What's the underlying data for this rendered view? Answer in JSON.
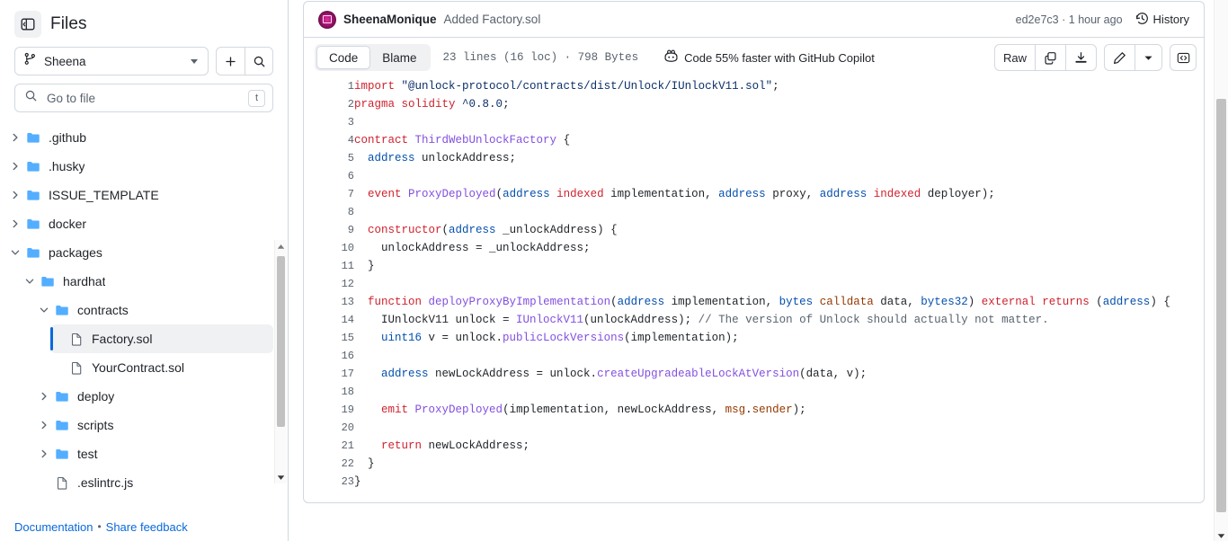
{
  "sidebar": {
    "title": "Files",
    "collapse_icon": "sidebar-collapse-icon",
    "branch": {
      "name": "Sheena",
      "icon": "git-branch-icon"
    },
    "add_button_icon": "plus-icon",
    "search_button_icon": "search-icon",
    "goto_file": {
      "placeholder": "Go to file",
      "value": "",
      "kbd": "t",
      "icon": "search-icon"
    },
    "tree": [
      {
        "label": ".github",
        "type": "folder",
        "depth": 0,
        "state": "collapsed",
        "selected": false
      },
      {
        "label": ".husky",
        "type": "folder",
        "depth": 0,
        "state": "collapsed",
        "selected": false
      },
      {
        "label": "ISSUE_TEMPLATE",
        "type": "folder",
        "depth": 0,
        "state": "collapsed",
        "selected": false
      },
      {
        "label": "docker",
        "type": "folder",
        "depth": 0,
        "state": "collapsed",
        "selected": false
      },
      {
        "label": "packages",
        "type": "folder",
        "depth": 0,
        "state": "expanded",
        "selected": false
      },
      {
        "label": "hardhat",
        "type": "folder",
        "depth": 1,
        "state": "expanded",
        "selected": false
      },
      {
        "label": "contracts",
        "type": "folder",
        "depth": 2,
        "state": "expanded",
        "selected": false
      },
      {
        "label": "Factory.sol",
        "type": "file",
        "depth": 3,
        "state": "none",
        "selected": true
      },
      {
        "label": "YourContract.sol",
        "type": "file",
        "depth": 3,
        "state": "none",
        "selected": false
      },
      {
        "label": "deploy",
        "type": "folder",
        "depth": 2,
        "state": "collapsed",
        "selected": false
      },
      {
        "label": "scripts",
        "type": "folder",
        "depth": 2,
        "state": "collapsed",
        "selected": false
      },
      {
        "label": "test",
        "type": "folder",
        "depth": 2,
        "state": "collapsed",
        "selected": false
      },
      {
        "label": ".eslintrc.js",
        "type": "file",
        "depth": 2,
        "state": "none",
        "selected": false
      }
    ],
    "footer": {
      "documentation": "Documentation",
      "separator": "•",
      "share_feedback": "Share feedback"
    }
  },
  "commit_bar": {
    "author": "SheenaMonique",
    "message": "Added Factory.sol",
    "sha": "ed2e7c3",
    "sha_separator": "·",
    "relative_time": "1 hour ago",
    "history_label": "History",
    "history_icon": "history-clock-icon"
  },
  "file_toolbar": {
    "tabs": [
      {
        "label": "Code",
        "active": true
      },
      {
        "label": "Blame",
        "active": false
      }
    ],
    "meta": "23 lines (16 loc) · 798 Bytes",
    "copilot": {
      "label": "Code 55% faster with GitHub Copilot",
      "icon": "copilot-icon"
    },
    "actions": {
      "raw": "Raw",
      "copy_icon": "copy-icon",
      "download_icon": "download-icon",
      "edit_icon": "pencil-icon",
      "more_icon": "chevron-down-icon",
      "symbols_icon": "code-brackets-icon"
    }
  },
  "code": {
    "language": "solidity",
    "line_count": 23,
    "lines": [
      {
        "n": 1,
        "tokens": [
          {
            "t": "import",
            "c": "k"
          },
          {
            "t": " ",
            "c": ""
          },
          {
            "t": "\"@unlock-protocol/contracts/dist/Unlock/IUnlockV11.sol\"",
            "c": "s"
          },
          {
            "t": ";",
            "c": ""
          }
        ]
      },
      {
        "n": 2,
        "tokens": [
          {
            "t": "pragma solidity",
            "c": "k"
          },
          {
            "t": " ",
            "c": ""
          },
          {
            "t": "^0.8.0",
            "c": "s"
          },
          {
            "t": ";",
            "c": ""
          }
        ]
      },
      {
        "n": 3,
        "tokens": []
      },
      {
        "n": 4,
        "tokens": [
          {
            "t": "contract",
            "c": "k"
          },
          {
            "t": " ",
            "c": ""
          },
          {
            "t": "ThirdWebUnlockFactory",
            "c": "e"
          },
          {
            "t": " {",
            "c": ""
          }
        ]
      },
      {
        "n": 5,
        "tokens": [
          {
            "t": "  ",
            "c": ""
          },
          {
            "t": "address",
            "c": "v"
          },
          {
            "t": " unlockAddress;",
            "c": ""
          }
        ]
      },
      {
        "n": 6,
        "tokens": []
      },
      {
        "n": 7,
        "tokens": [
          {
            "t": "  ",
            "c": ""
          },
          {
            "t": "event",
            "c": "k"
          },
          {
            "t": " ",
            "c": ""
          },
          {
            "t": "ProxyDeployed",
            "c": "e"
          },
          {
            "t": "(",
            "c": ""
          },
          {
            "t": "address",
            "c": "v"
          },
          {
            "t": " ",
            "c": ""
          },
          {
            "t": "indexed",
            "c": "k"
          },
          {
            "t": " implementation, ",
            "c": ""
          },
          {
            "t": "address",
            "c": "v"
          },
          {
            "t": " proxy, ",
            "c": ""
          },
          {
            "t": "address",
            "c": "v"
          },
          {
            "t": " ",
            "c": ""
          },
          {
            "t": "indexed",
            "c": "k"
          },
          {
            "t": " deployer);",
            "c": ""
          }
        ]
      },
      {
        "n": 8,
        "tokens": []
      },
      {
        "n": 9,
        "tokens": [
          {
            "t": "  ",
            "c": ""
          },
          {
            "t": "constructor",
            "c": "k"
          },
          {
            "t": "(",
            "c": ""
          },
          {
            "t": "address",
            "c": "v"
          },
          {
            "t": " _unlockAddress) {",
            "c": ""
          }
        ]
      },
      {
        "n": 10,
        "tokens": [
          {
            "t": "    unlockAddress = _unlockAddress;",
            "c": ""
          }
        ]
      },
      {
        "n": 11,
        "tokens": [
          {
            "t": "  }",
            "c": ""
          }
        ]
      },
      {
        "n": 12,
        "tokens": []
      },
      {
        "n": 13,
        "tokens": [
          {
            "t": "  ",
            "c": ""
          },
          {
            "t": "function",
            "c": "k"
          },
          {
            "t": " ",
            "c": ""
          },
          {
            "t": "deployProxyByImplementation",
            "c": "e"
          },
          {
            "t": "(",
            "c": ""
          },
          {
            "t": "address",
            "c": "v"
          },
          {
            "t": " implementation, ",
            "c": ""
          },
          {
            "t": "bytes",
            "c": "v"
          },
          {
            "t": " ",
            "c": ""
          },
          {
            "t": "calldata",
            "c": "t"
          },
          {
            "t": " data, ",
            "c": ""
          },
          {
            "t": "bytes32",
            "c": "v"
          },
          {
            "t": ") ",
            "c": ""
          },
          {
            "t": "external returns",
            "c": "k"
          },
          {
            "t": " (",
            "c": ""
          },
          {
            "t": "address",
            "c": "v"
          },
          {
            "t": ") {",
            "c": ""
          }
        ]
      },
      {
        "n": 14,
        "tokens": [
          {
            "t": "    IUnlockV11 unlock = ",
            "c": ""
          },
          {
            "t": "IUnlockV11",
            "c": "e"
          },
          {
            "t": "(unlockAddress); ",
            "c": ""
          },
          {
            "t": "// The version of Unlock should actually not matter.",
            "c": "c"
          }
        ]
      },
      {
        "n": 15,
        "tokens": [
          {
            "t": "    ",
            "c": ""
          },
          {
            "t": "uint16",
            "c": "v"
          },
          {
            "t": " v = unlock.",
            "c": ""
          },
          {
            "t": "publicLockVersions",
            "c": "e"
          },
          {
            "t": "(implementation);",
            "c": ""
          }
        ]
      },
      {
        "n": 16,
        "tokens": []
      },
      {
        "n": 17,
        "tokens": [
          {
            "t": "    ",
            "c": ""
          },
          {
            "t": "address",
            "c": "v"
          },
          {
            "t": " newLockAddress = unlock.",
            "c": ""
          },
          {
            "t": "createUpgradeableLockAtVersion",
            "c": "e"
          },
          {
            "t": "(data, v);",
            "c": ""
          }
        ]
      },
      {
        "n": 18,
        "tokens": []
      },
      {
        "n": 19,
        "tokens": [
          {
            "t": "    ",
            "c": ""
          },
          {
            "t": "emit",
            "c": "k"
          },
          {
            "t": " ",
            "c": ""
          },
          {
            "t": "ProxyDeployed",
            "c": "e"
          },
          {
            "t": "(implementation, newLockAddress, ",
            "c": ""
          },
          {
            "t": "msg",
            "c": "t"
          },
          {
            "t": ".",
            "c": ""
          },
          {
            "t": "sender",
            "c": "t"
          },
          {
            "t": ");",
            "c": ""
          }
        ]
      },
      {
        "n": 20,
        "tokens": []
      },
      {
        "n": 21,
        "tokens": [
          {
            "t": "    ",
            "c": ""
          },
          {
            "t": "return",
            "c": "k"
          },
          {
            "t": " newLockAddress;",
            "c": ""
          }
        ]
      },
      {
        "n": 22,
        "tokens": [
          {
            "t": "  }",
            "c": ""
          }
        ]
      },
      {
        "n": 23,
        "tokens": [
          {
            "t": "}",
            "c": ""
          }
        ]
      }
    ]
  },
  "colors": {
    "keyword": "#cf222e",
    "string": "#0a3069",
    "entity": "#8250df",
    "constant": "#0550ae",
    "type": "#953800",
    "comment": "#59636e",
    "link": "#0969da",
    "border": "#d1d9e0",
    "muted_text": "#59636e",
    "selected_bg": "#f0f1f3"
  }
}
